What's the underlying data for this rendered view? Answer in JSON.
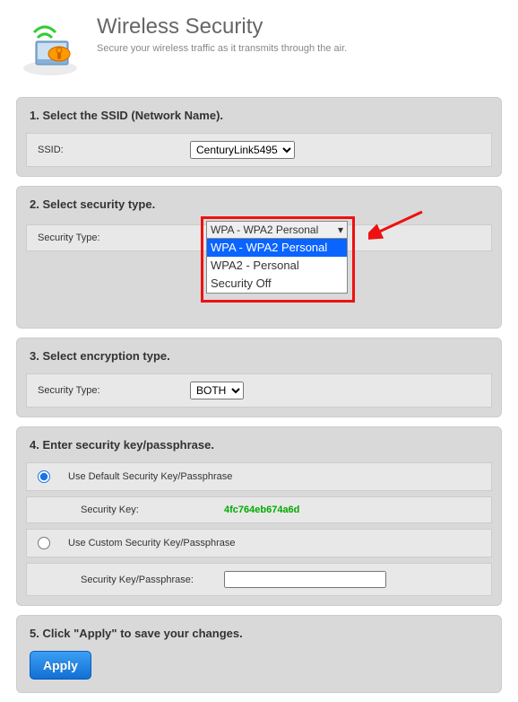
{
  "header": {
    "title": "Wireless Security",
    "subtitle": "Secure your wireless traffic as it transmits through the air."
  },
  "step1": {
    "title": "1. Select the SSID (Network Name).",
    "label": "SSID:",
    "value": "CenturyLink5495"
  },
  "step2": {
    "title": "2. Select security type.",
    "label": "Security Type:",
    "value": "WPA - WPA2 Personal",
    "options": [
      "WPA - WPA2 Personal",
      "WPA2 - Personal",
      "Security Off"
    ]
  },
  "step3": {
    "title": "3. Select encryption type.",
    "label": "Security Type:",
    "value": "BOTH"
  },
  "step4": {
    "title": "4. Enter security key/passphrase.",
    "option_default": "Use Default Security Key/Passphrase",
    "seckey_label": "Security Key:",
    "seckey_value": "4fc764eb674a6d",
    "option_custom": "Use Custom Security Key/Passphrase",
    "custom_label": "Security Key/Passphrase:",
    "custom_value": ""
  },
  "step5": {
    "title": "5. Click \"Apply\" to save your changes.",
    "button": "Apply"
  }
}
